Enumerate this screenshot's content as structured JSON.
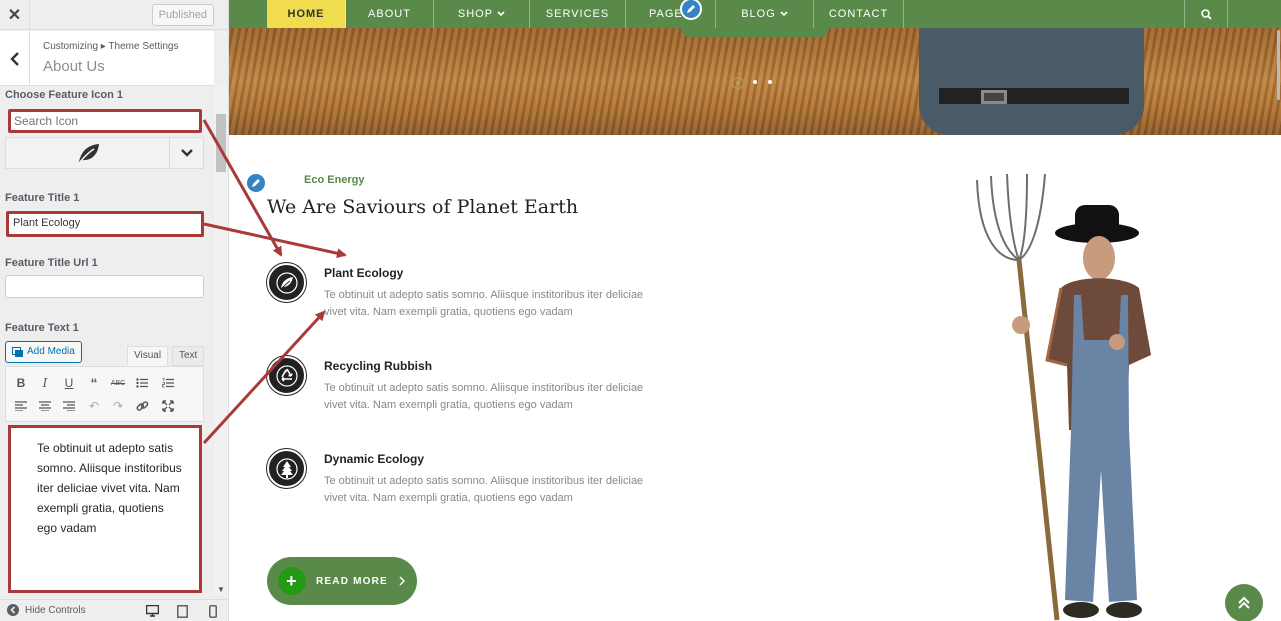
{
  "panel": {
    "close_icon": "close-icon",
    "published_label": "Published",
    "breadcrumb": "Customizing ▸ Theme Settings",
    "section_title": "About Us",
    "icon_label": "Choose Feature Icon 1",
    "icon_search_placeholder": "Search Icon",
    "selected_icon": "leaf-icon",
    "title_label": "Feature Title 1",
    "title_value": "Plant Ecology",
    "url_label": "Feature Title Url 1",
    "url_value": "",
    "text_label": "Feature Text 1",
    "add_media_label": "Add Media",
    "tab_visual": "Visual",
    "tab_text": "Text",
    "editor_text": "Te obtinuit ut adepto satis somno. Aliisque institoribus iter deliciae vivet vita. Nam exempli gratia, quotiens ego vadam",
    "hide_controls_label": "Hide Controls"
  },
  "nav": {
    "items": [
      "HOME",
      "ABOUT",
      "SHOP",
      "SERVICES",
      "PAGE",
      "BLOG",
      "CONTACT"
    ],
    "active": "HOME"
  },
  "about": {
    "eyebrow": "Eco Energy",
    "heading": "We Are Saviours of Planet Earth",
    "features": [
      {
        "title": "Plant Ecology",
        "text": "Te obtinuit ut adepto satis somno. Aliisque institoribus iter deliciae vivet vita. Nam exempli gratia, quotiens ego vadam",
        "icon": "leaf-icon"
      },
      {
        "title": "Recycling Rubbish",
        "text": "Te obtinuit ut adepto satis somno. Aliisque institoribus iter deliciae vivet vita. Nam exempli gratia, quotiens ego vadam",
        "icon": "recycle-icon"
      },
      {
        "title": "Dynamic Ecology",
        "text": "Te obtinuit ut adepto satis somno. Aliisque institoribus iter deliciae vivet vita. Nam exempli gratia, quotiens ego vadam",
        "icon": "tree-icon"
      }
    ],
    "read_more_label": "READ MORE"
  },
  "colors": {
    "brand_green": "#5a8a4a",
    "active_nav": "#f0dc4e",
    "annotation_red": "#a83a3a",
    "plus_green": "#239a15"
  }
}
